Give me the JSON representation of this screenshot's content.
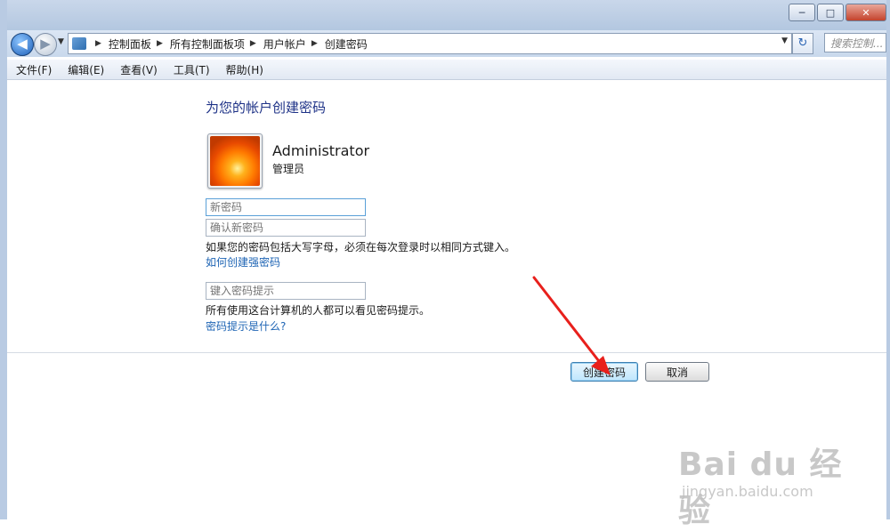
{
  "window": {
    "controls": {
      "minimize": "─",
      "maximize": "□",
      "close": "✕"
    }
  },
  "nav": {
    "back_icon": "arrow-left-icon",
    "forward_icon": "arrow-right-icon",
    "breadcrumbs": [
      "控制面板",
      "所有控制面板项",
      "用户帐户",
      "创建密码"
    ],
    "search_placeholder": "搜索控制..."
  },
  "menu": {
    "items": [
      "文件(F)",
      "编辑(E)",
      "查看(V)",
      "工具(T)",
      "帮助(H)"
    ]
  },
  "main": {
    "title": "为您的帐户创建密码",
    "user": {
      "name": "Administrator",
      "role": "管理员"
    },
    "new_password_placeholder": "新密码",
    "confirm_password_placeholder": "确认新密码",
    "case_note": "如果您的密码包括大写字母，必须在每次登录时以相同方式键入。",
    "strong_link": "如何创建强密码",
    "hint_placeholder": "键入密码提示",
    "hint_note": "所有使用这台计算机的人都可以看见密码提示。",
    "hint_link": "密码提示是什么?",
    "create_button": "创建密码",
    "cancel_button": "取消"
  },
  "watermark": {
    "logo": "Bai du 经验",
    "url": "jingyan.baidu.com"
  },
  "colors": {
    "title": "#1e3287",
    "link": "#1e64b4",
    "arrow": "#e8201c"
  }
}
